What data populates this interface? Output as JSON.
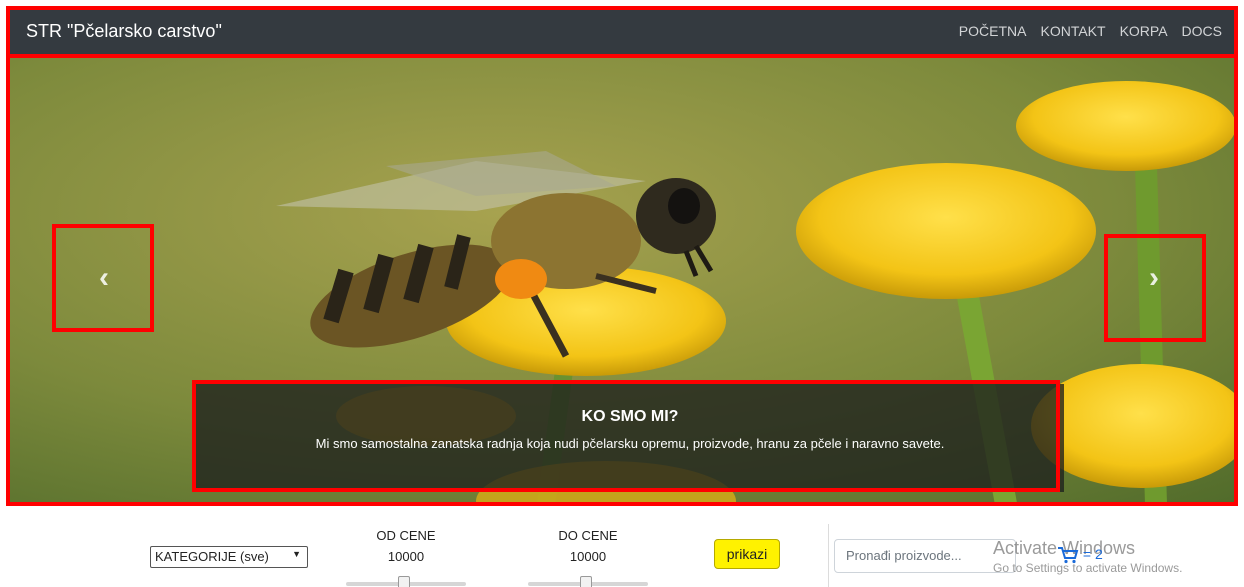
{
  "navbar": {
    "brand": "STR \"Pčelarsko carstvo\"",
    "links": [
      "POČETNA",
      "KONTAKT",
      "KORPA",
      "DOCS"
    ]
  },
  "hero": {
    "prev_glyph": "‹",
    "next_glyph": "›",
    "caption_title": "KO SMO MI?",
    "caption_text": "Mi smo samostalna zanatska radnja koja nudi pčelarsku opremu, proizvode, hranu za pčele i naravno savete."
  },
  "filters": {
    "category_selected": "KATEGORIJE (sve)",
    "price_from_label": "OD CENE",
    "price_from_value": "10000",
    "price_to_label": "DO CENE",
    "price_to_value": "10000",
    "show_button": "prikazi",
    "search_placeholder": "Pronađi proizvode...",
    "cart_count": "= 2"
  },
  "watermark": {
    "line1": "Activate Windows",
    "line2": "Go to Settings to activate Windows."
  },
  "colors": {
    "navbar_bg": "#343a40",
    "annotation_red": "#ff0000",
    "button_yellow": "#fff200",
    "cart_blue": "#1a6ad9"
  }
}
